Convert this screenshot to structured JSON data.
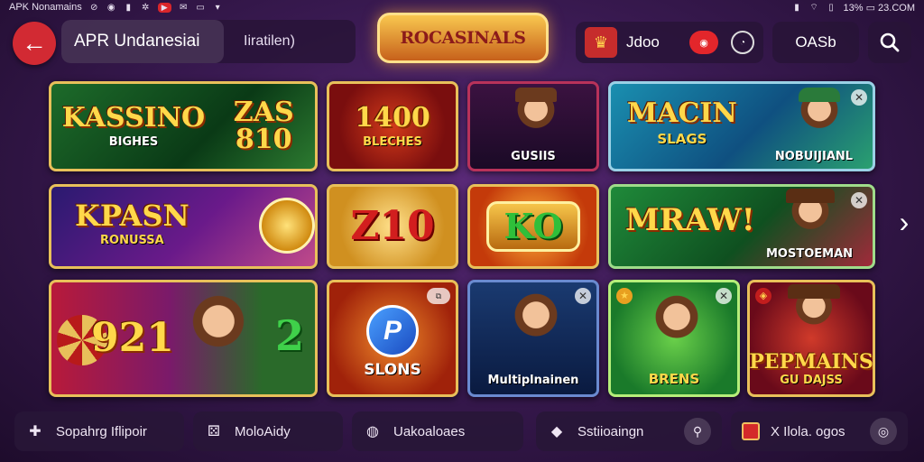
{
  "statusbar": {
    "left_text": "APK Nonamains",
    "right_text": "13% ▭ 23.COM"
  },
  "header": {
    "app_title": "APR Undanesiai",
    "subtitle": "Iiratilen)",
    "logo_text": "ROCASINALS",
    "coins_value": "Jdoo",
    "dash_label": "OASb"
  },
  "tiles": [
    {
      "title": "KASSINO",
      "sub": "BIGHES",
      "big": "ZAS 810"
    },
    {
      "title": "1400",
      "sub": "BLECHES"
    },
    {
      "title": "",
      "sub": "GUSIIS"
    },
    {
      "title": "MACIN",
      "sub": "SLAGS",
      "caption": "NOBUIJIANL"
    },
    {
      "title": "KPASN",
      "sub": "RONUSSA"
    },
    {
      "title": "Z10",
      "sub": ""
    },
    {
      "title": "KO",
      "sub": ""
    },
    {
      "title": "MRAW!",
      "sub": "",
      "caption": "MOSTOEMAN"
    },
    {
      "title": "921",
      "sub": "",
      "big": "2"
    },
    {
      "title": "",
      "sub": "SLONS"
    },
    {
      "title": "",
      "sub": "Multiplnainen"
    },
    {
      "title": "",
      "sub": "BRENS"
    },
    {
      "title": "PEPMAINS",
      "sub": "GU DAJSS"
    }
  ],
  "bottom_nav": [
    {
      "label": "Sopahrg Iflipoir",
      "icon": "puzzle-icon"
    },
    {
      "label": "MoloAidy",
      "icon": "dice-icon"
    },
    {
      "label": "Uakoaloaes",
      "icon": "gamepad-icon"
    },
    {
      "label": "Sstiioaingn",
      "icon": "tag-icon"
    },
    {
      "label": "X Ilola. ogos",
      "icon": "chip-icon"
    }
  ],
  "colors": {
    "accent": "#d22a33",
    "gold": "#e8c05a",
    "bg": "#3a1a52"
  }
}
